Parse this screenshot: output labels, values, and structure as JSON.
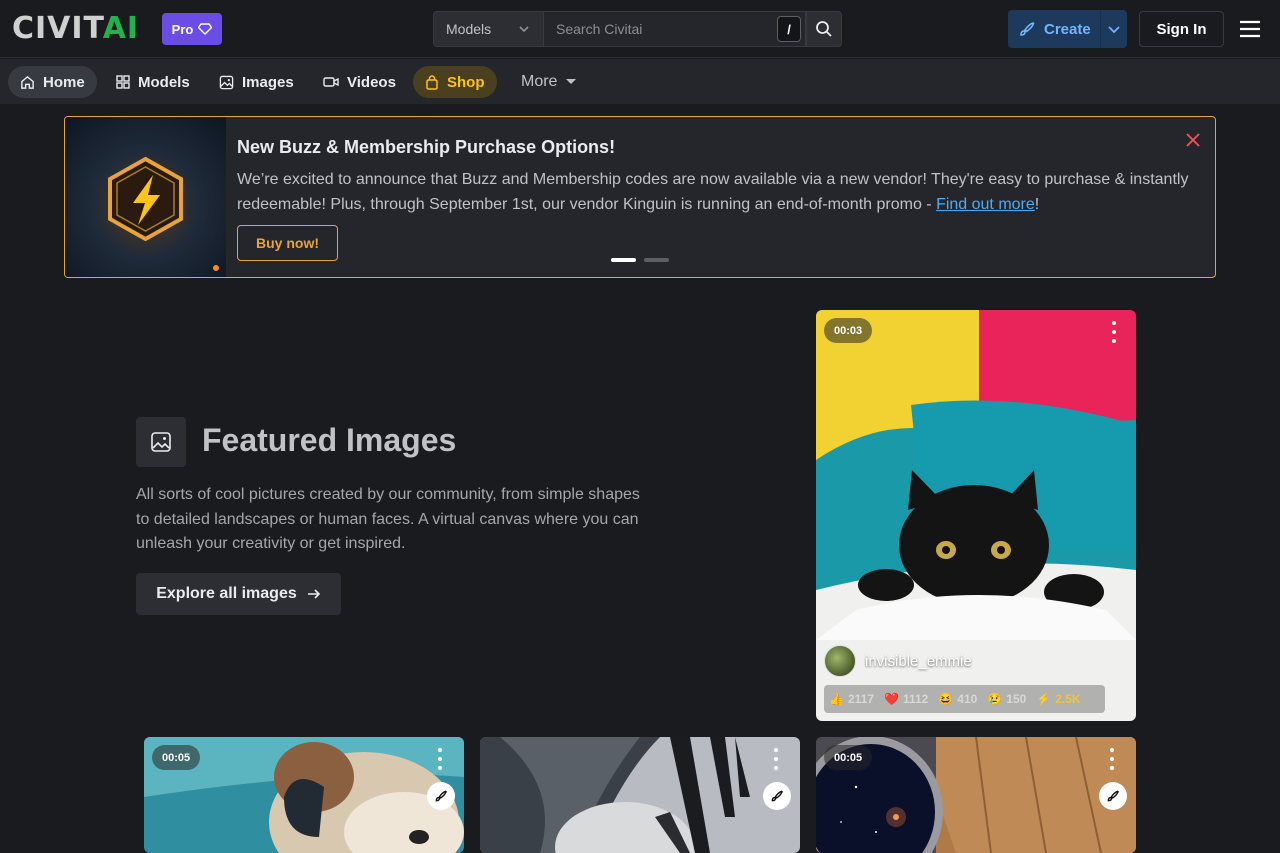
{
  "header": {
    "logo_left": "CIVIT",
    "logo_right": "AI",
    "pro_label": "Pro",
    "search": {
      "category": "Models",
      "placeholder": "Search Civitai",
      "shortcut": "/"
    },
    "create_label": "Create",
    "signin_label": "Sign In"
  },
  "nav": {
    "items": [
      {
        "label": "Home",
        "icon": "home-icon"
      },
      {
        "label": "Models",
        "icon": "grid-icon"
      },
      {
        "label": "Images",
        "icon": "image-icon"
      },
      {
        "label": "Videos",
        "icon": "video-icon"
      },
      {
        "label": "Shop",
        "icon": "shopping-bag-icon"
      }
    ],
    "more_label": "More"
  },
  "banner": {
    "title": "New Buzz & Membership Purchase Options!",
    "text": "We’re excited to announce that Buzz and Membership codes are now available via a new vendor! They're easy to purchase & instantly redeemable! Plus, through September 1st, our vendor Kinguin is running an end-of-month promo - ",
    "link": "Find out more",
    "text_end": "!",
    "button": "Buy now!",
    "slide_count": 2,
    "active_slide": 1
  },
  "featured": {
    "title": "Featured Images",
    "description": "All sorts of cool pictures created by our community, from simple shapes to detailed landscapes or human faces. A virtual canvas where you can unleash your creativity or get inspired.",
    "button": "Explore all images"
  },
  "cards": {
    "main": {
      "duration": "00:03",
      "username": "invisible_emmie",
      "reactions": {
        "like": "2117",
        "heart": "1112",
        "laugh": "410",
        "cry": "150",
        "buzz": "2.5K"
      }
    },
    "row": [
      {
        "duration": "00:05"
      },
      {
        "duration": ""
      },
      {
        "duration": "00:05"
      }
    ]
  },
  "colors": {
    "accent": "#e8a33d",
    "pro": "#6a4ee4",
    "brand_green": "#23b14d",
    "link": "#4dabf7"
  }
}
